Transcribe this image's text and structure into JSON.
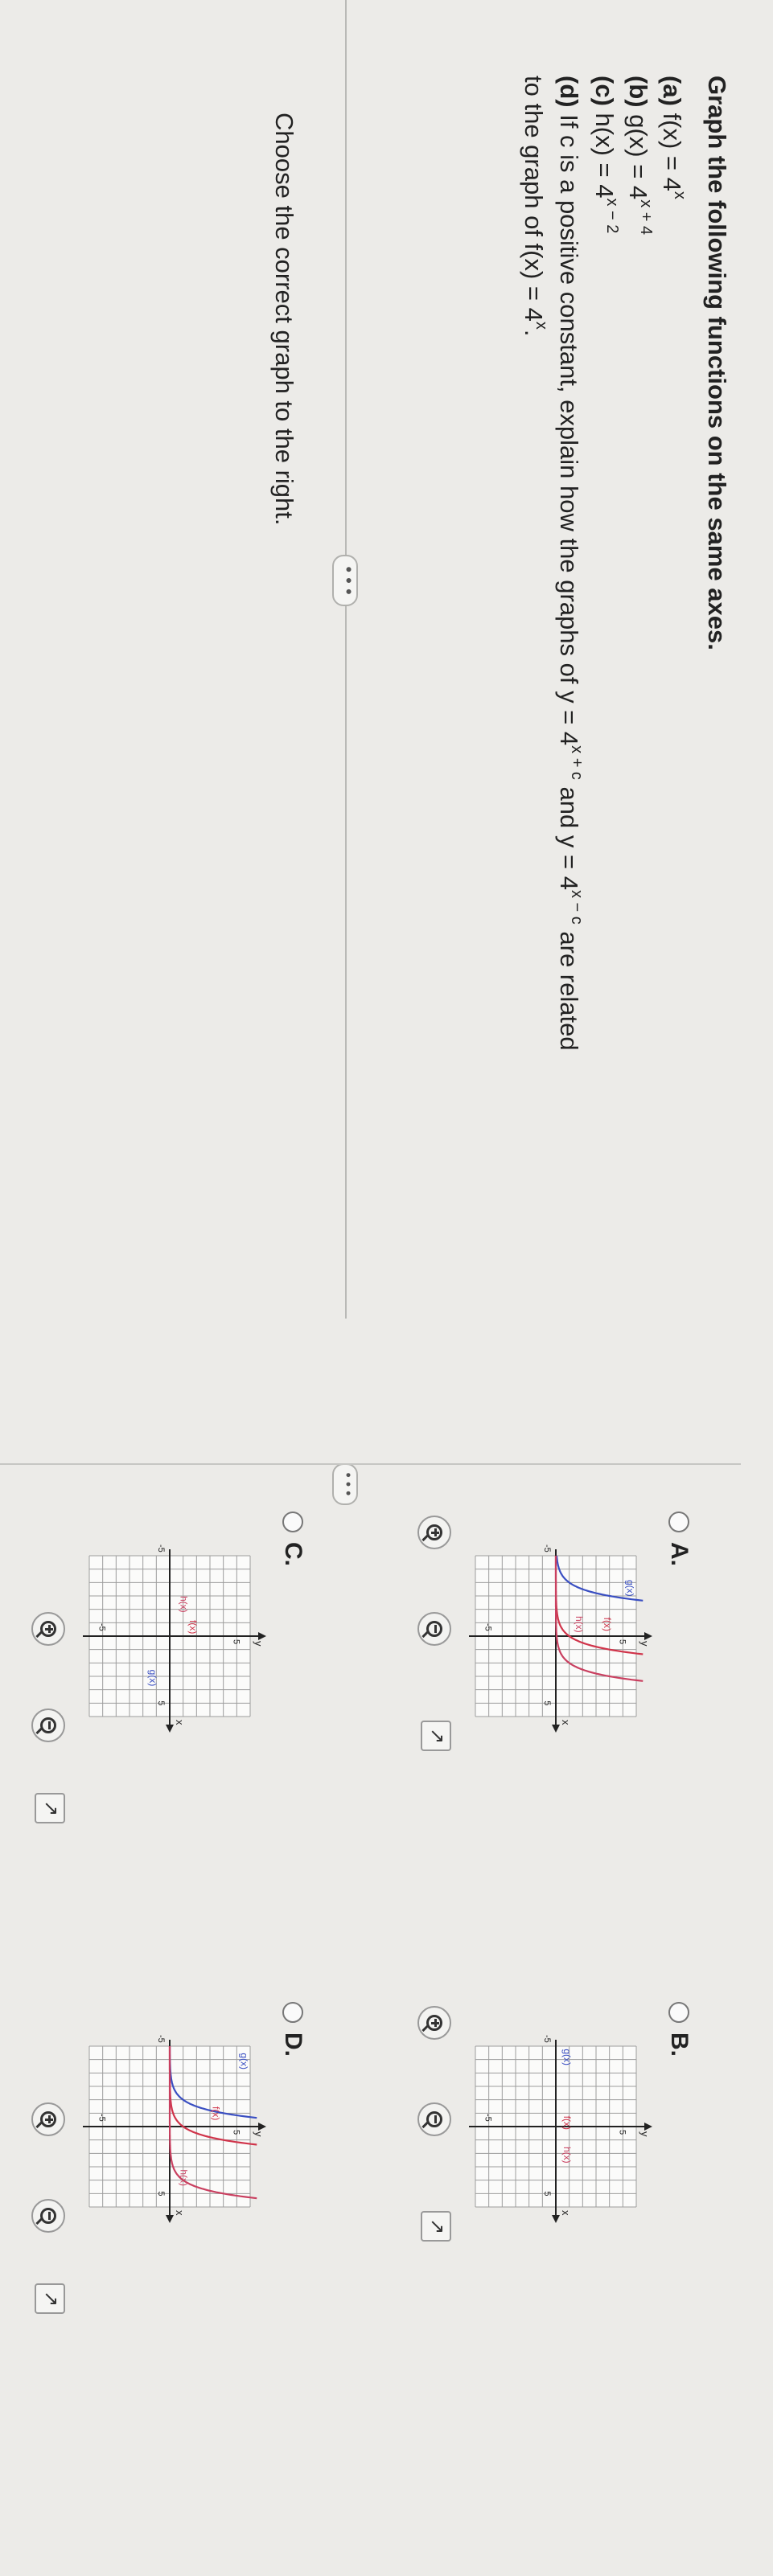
{
  "question": {
    "title": "Graph the following functions on the same axes.",
    "a_label": "(a)",
    "a_text": "f(x) = 4",
    "a_exp": "x",
    "b_label": "(b)",
    "b_text": "g(x) = 4",
    "b_exp": "x + 4",
    "c_label": "(c)",
    "c_text": "h(x) = 4",
    "c_exp": "x − 2",
    "d_label": "(d)",
    "d_text1": "If c is a positive constant, explain how the graphs of y = 4",
    "d_exp1": "x + c",
    "d_text2": " and y = 4",
    "d_exp2": "x − c",
    "d_text3": " are related",
    "d_line2": "to the graph of f(x) = 4",
    "d_exp3": "x",
    "d_end": ".",
    "more": "• • •"
  },
  "prompt": "Choose the correct graph to the right.",
  "options": [
    {
      "letter": "A.",
      "labels": {
        "g": "g(x)",
        "f": "f(x)",
        "h": "h(x)",
        "y": "y",
        "x": "x",
        "five_top": "5",
        "five_right": "5",
        "neg_five": "-5",
        "neg_five_bottom": "-5"
      }
    },
    {
      "letter": "B.",
      "labels": {
        "g": "g(x)",
        "f": "f(x)",
        "h": "h(x)",
        "y": "y",
        "x": "x",
        "five_top": "5",
        "five_right": "5",
        "neg_five": "-5",
        "neg_five_bottom": "-5"
      }
    },
    {
      "letter": "C.",
      "labels": {
        "g": "g(x)",
        "f": "f(x)",
        "h": "h(x)",
        "y": "y",
        "x": "x",
        "five_top": "5",
        "five_right": "5",
        "neg_five": "-5",
        "neg_five_bottom": "-5"
      }
    },
    {
      "letter": "D.",
      "labels": {
        "g": "g(x)",
        "f": "f(x)",
        "h": "h(x)",
        "y": "y",
        "x": "x",
        "five_top": "5",
        "five_right": "5",
        "neg_five": "-5",
        "neg_five_bottom": "-5"
      }
    }
  ],
  "colors": {
    "g": "#3a4fc2",
    "f": "#d0344a",
    "h": "#c94060",
    "grid": "#9c9c9c",
    "axis": "#222222"
  }
}
